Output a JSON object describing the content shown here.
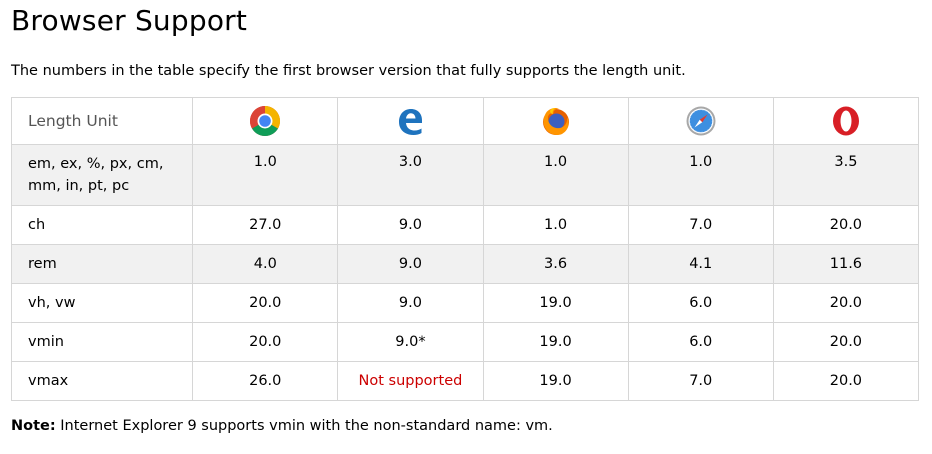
{
  "page": {
    "title": "Browser Support",
    "intro": "The numbers in the table specify the first browser version that fully supports the length unit."
  },
  "table": {
    "unit_header": "Length Unit",
    "browsers": [
      {
        "icon": "chrome-icon"
      },
      {
        "icon": "edge-icon"
      },
      {
        "icon": "firefox-icon"
      },
      {
        "icon": "safari-icon"
      },
      {
        "icon": "opera-icon"
      }
    ],
    "rows": [
      {
        "unit": "em, ex, %, px, cm, mm, in, pt, pc",
        "values": [
          "1.0",
          "3.0",
          "1.0",
          "1.0",
          "3.5"
        ]
      },
      {
        "unit": "ch",
        "values": [
          "27.0",
          "9.0",
          "1.0",
          "7.0",
          "20.0"
        ]
      },
      {
        "unit": "rem",
        "values": [
          "4.0",
          "9.0",
          "3.6",
          "4.1",
          "11.6"
        ]
      },
      {
        "unit": "vh, vw",
        "values": [
          "20.0",
          "9.0",
          "19.0",
          "6.0",
          "20.0"
        ]
      },
      {
        "unit": "vmin",
        "values": [
          "20.0",
          "9.0*",
          "19.0",
          "6.0",
          "20.0"
        ]
      },
      {
        "unit": "vmax",
        "values": [
          "26.0",
          "Not supported",
          "19.0",
          "7.0",
          "20.0"
        ]
      }
    ]
  },
  "note": {
    "label": "Note:",
    "text": " Internet Explorer 9 supports vmin with the non-standard name: vm."
  },
  "colors": {
    "border": "#d6d6d6",
    "row_shade": "#f1f1f1",
    "not_supported": "#cc0000"
  }
}
